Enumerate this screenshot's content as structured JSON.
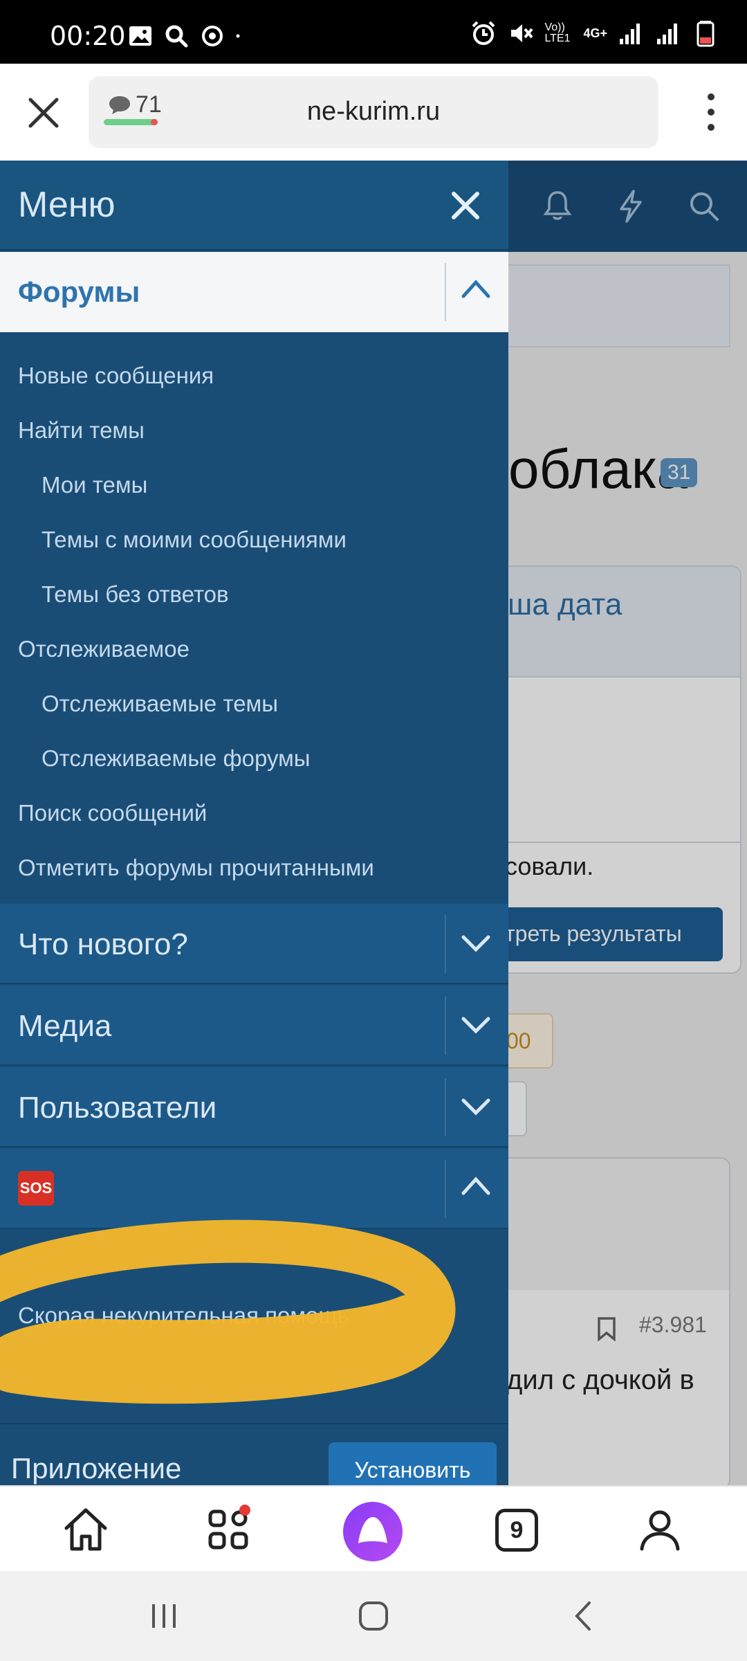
{
  "status_bar": {
    "time": "00:20",
    "left_icons": [
      "image-icon",
      "search-icon",
      "sync-icon",
      "dot-icon"
    ],
    "right_icons": [
      "alarm-icon",
      "mute-icon",
      "volte-icon",
      "4g-icon",
      "signal-icon",
      "signal-icon",
      "battery-low-icon"
    ],
    "volte_label": "Vo)) LTE1",
    "network_label": "4G+"
  },
  "browser": {
    "comments_count": "71",
    "url": "ne-kurim.ru"
  },
  "page": {
    "title_fragment": "облака",
    "title_badge": "31",
    "poll_subtitle": "ша дата",
    "poll_voted_text": "совали.",
    "poll_button": "треть результаты",
    "tag_value": "00",
    "post_number": "#3.981",
    "post_text": "дил с дочкой в"
  },
  "menu": {
    "title": "Меню",
    "forums_label": "Форумы",
    "forum_items": [
      {
        "label": "Новые сообщения",
        "indent": false
      },
      {
        "label": "Найти темы",
        "indent": false
      },
      {
        "label": "Мои темы",
        "indent": true
      },
      {
        "label": "Темы с моими сообщениями",
        "indent": true
      },
      {
        "label": "Темы без ответов",
        "indent": true
      },
      {
        "label": "Отслеживаемое",
        "indent": false
      },
      {
        "label": "Отслеживаемые темы",
        "indent": true
      },
      {
        "label": "Отслеживаемые форумы",
        "indent": true
      },
      {
        "label": "Поиск сообщений",
        "indent": false
      },
      {
        "label": "Отметить форумы прочитанными",
        "indent": false
      }
    ],
    "sections": [
      {
        "label": "Что нового?"
      },
      {
        "label": "Медиа"
      },
      {
        "label": "Пользователи"
      }
    ],
    "sos_label": "SOS",
    "sos_items": [
      "Скорая некурительная помощь"
    ],
    "app_label": "Приложение",
    "install_button": "Установить"
  },
  "bottom_nav": {
    "icons": [
      "home-icon",
      "apps-icon",
      "alice-icon",
      "tabs-icon",
      "profile-icon"
    ],
    "tabs_count": "9",
    "apps_notification_color": "#e53935"
  },
  "colors": {
    "menu_bg": "#184f7a",
    "accent": "#2e73ae",
    "highlight_scribble": "#f2b62b"
  }
}
